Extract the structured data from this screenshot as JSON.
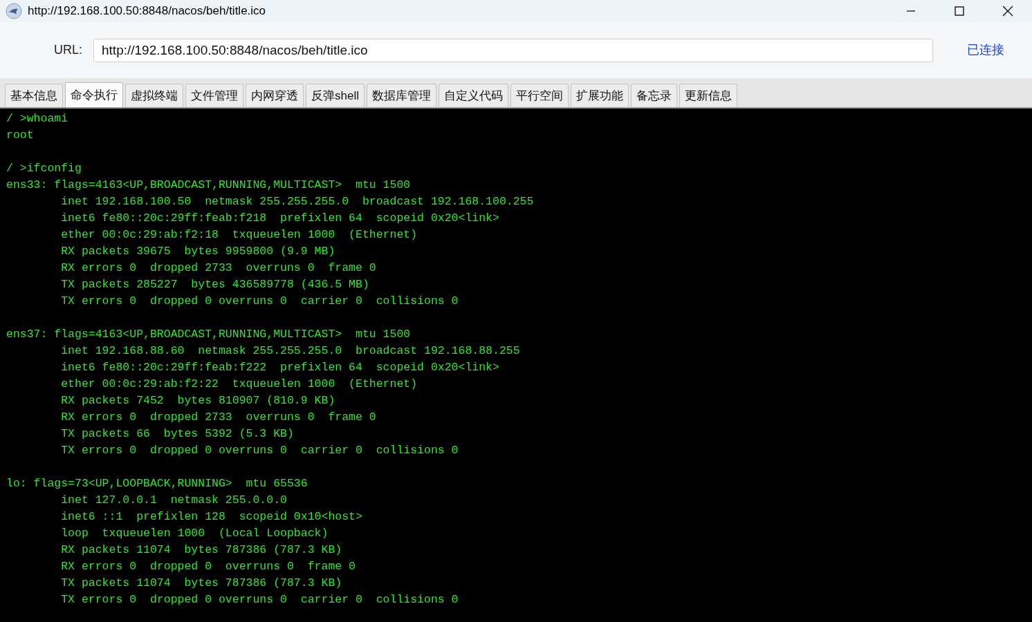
{
  "window": {
    "title": "http://192.168.100.50:8848/nacos/beh/title.ico"
  },
  "url_bar": {
    "label": "URL:",
    "value": "http://192.168.100.50:8848/nacos/beh/title.ico",
    "status": "已连接"
  },
  "tabs": [
    {
      "label": "基本信息",
      "selected": false
    },
    {
      "label": "命令执行",
      "selected": true
    },
    {
      "label": "虚拟终端",
      "selected": false
    },
    {
      "label": "文件管理",
      "selected": false
    },
    {
      "label": "内网穿透",
      "selected": false
    },
    {
      "label": "反弹shell",
      "selected": false
    },
    {
      "label": "数据库管理",
      "selected": false
    },
    {
      "label": "自定义代码",
      "selected": false
    },
    {
      "label": "平行空间",
      "selected": false
    },
    {
      "label": "扩展功能",
      "selected": false
    },
    {
      "label": "备忘录",
      "selected": false
    },
    {
      "label": "更新信息",
      "selected": false
    }
  ],
  "terminal": {
    "blocks": [
      {
        "lines": [
          "/ >whoami",
          "root"
        ]
      },
      {
        "lines": [
          "/ >ifconfig",
          "ens33: flags=4163<UP,BROADCAST,RUNNING,MULTICAST>  mtu 1500",
          "        inet 192.168.100.50  netmask 255.255.255.0  broadcast 192.168.100.255",
          "        inet6 fe80::20c:29ff:feab:f218  prefixlen 64  scopeid 0x20<link>",
          "        ether 00:0c:29:ab:f2:18  txqueuelen 1000  (Ethernet)",
          "        RX packets 39675  bytes 9959800 (9.9 MB)",
          "        RX errors 0  dropped 2733  overruns 0  frame 0",
          "        TX packets 285227  bytes 436589778 (436.5 MB)",
          "        TX errors 0  dropped 0 overruns 0  carrier 0  collisions 0"
        ]
      },
      {
        "lines": [
          "ens37: flags=4163<UP,BROADCAST,RUNNING,MULTICAST>  mtu 1500",
          "        inet 192.168.88.60  netmask 255.255.255.0  broadcast 192.168.88.255",
          "        inet6 fe80::20c:29ff:feab:f222  prefixlen 64  scopeid 0x20<link>",
          "        ether 00:0c:29:ab:f2:22  txqueuelen 1000  (Ethernet)",
          "        RX packets 7452  bytes 810907 (810.9 KB)",
          "        RX errors 0  dropped 2733  overruns 0  frame 0",
          "        TX packets 66  bytes 5392 (5.3 KB)",
          "        TX errors 0  dropped 0 overruns 0  carrier 0  collisions 0"
        ]
      },
      {
        "lines": [
          "lo: flags=73<UP,LOOPBACK,RUNNING>  mtu 65536",
          "        inet 127.0.0.1  netmask 255.0.0.0",
          "        inet6 ::1  prefixlen 128  scopeid 0x10<host>",
          "        loop  txqueuelen 1000  (Local Loopback)",
          "        RX packets 11074  bytes 787386 (787.3 KB)",
          "        RX errors 0  dropped 0  overruns 0  frame 0",
          "        TX packets 11074  bytes 787386 (787.3 KB)",
          "        TX errors 0  dropped 0 overruns 0  carrier 0  collisions 0"
        ]
      }
    ]
  }
}
